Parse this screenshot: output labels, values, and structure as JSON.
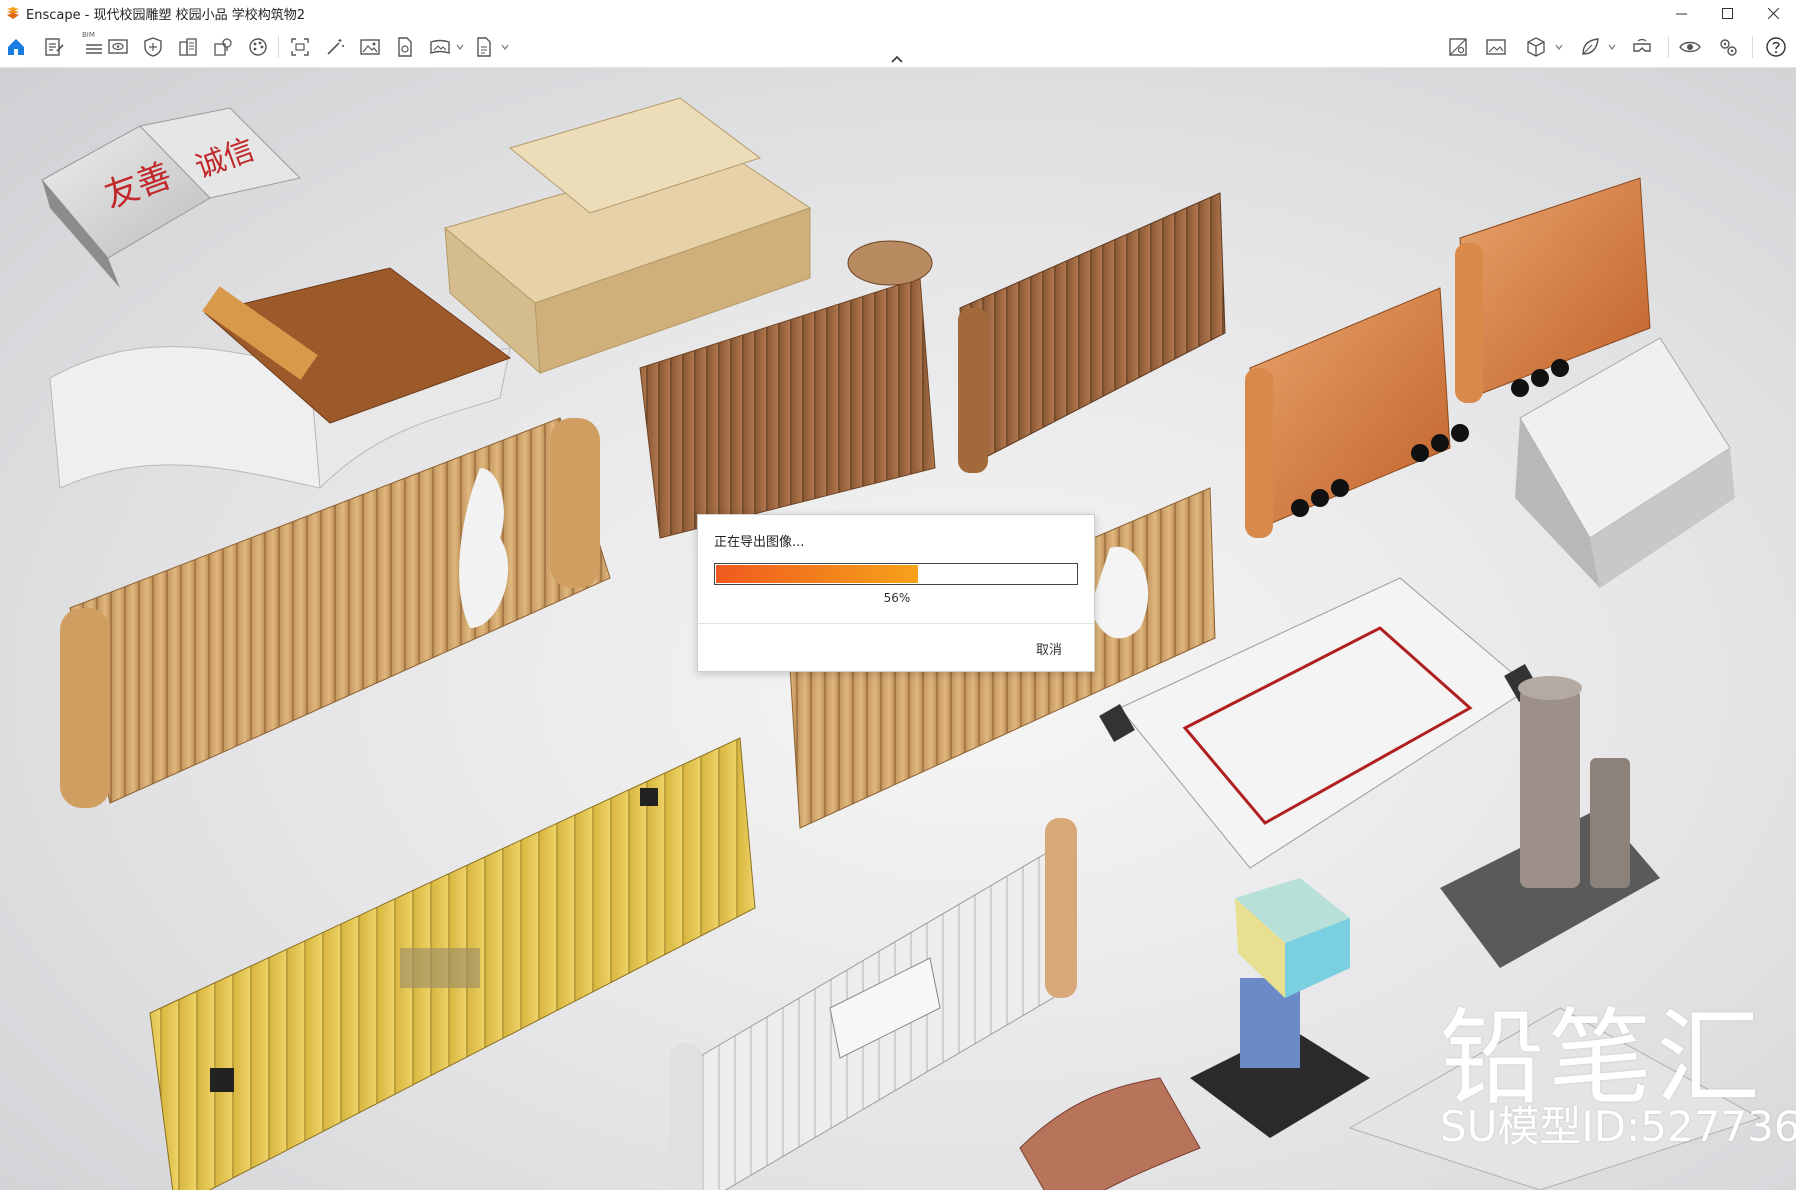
{
  "window": {
    "app_name": "Enscape",
    "title": "Enscape - 现代校园雕塑 校园小品 学校构筑物2"
  },
  "toolbar": {
    "bim_label": "BIM"
  },
  "dialog": {
    "title": "正在导出图像...",
    "progress": 0.56,
    "progress_text": "56%",
    "cancel_label": "取消"
  },
  "watermark": {
    "brand": "铅笔汇",
    "model_id": "SU模型ID:527736"
  },
  "colors": {
    "accent": "#1a7be0",
    "progress_start": "#ef5a1e",
    "progress_end": "#f7a21a",
    "logo": "#f5a623"
  }
}
